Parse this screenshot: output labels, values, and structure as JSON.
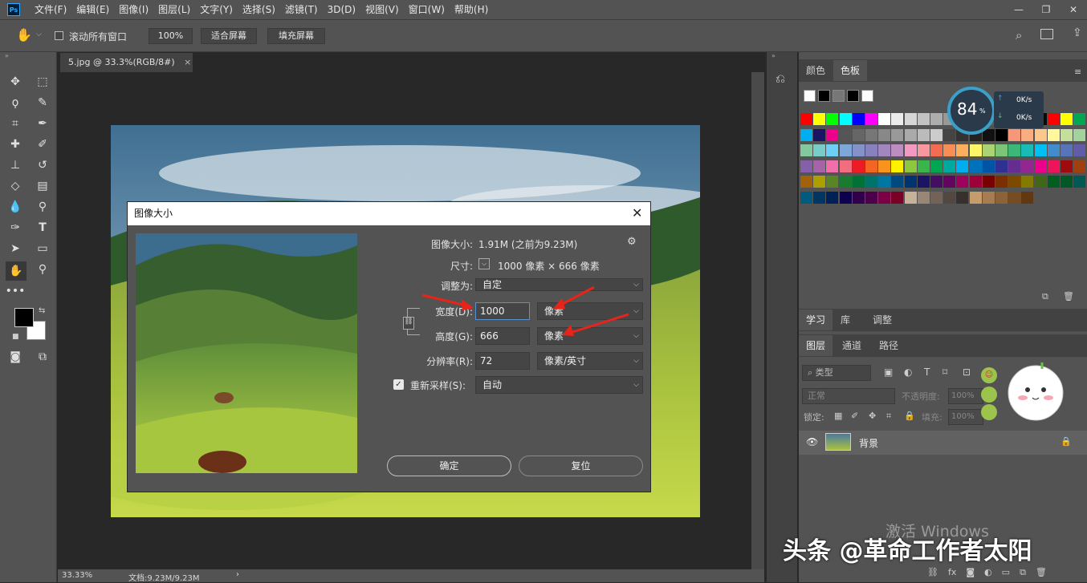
{
  "menubar": {
    "items": [
      "文件(F)",
      "编辑(E)",
      "图像(I)",
      "图层(L)",
      "文字(Y)",
      "选择(S)",
      "滤镜(T)",
      "3D(D)",
      "视图(V)",
      "窗口(W)",
      "帮助(H)"
    ],
    "logo": "Ps"
  },
  "options": {
    "scroll_all_label": "滚动所有窗口",
    "zoom_value": "100%",
    "fit_screen_label": "适合屏幕",
    "fill_screen_label": "填充屏幕"
  },
  "document": {
    "tab_title": "5.jpg @ 33.3%(RGB/8#)",
    "close_glyph": "×"
  },
  "statusbar": {
    "zoom": "33.33%",
    "doc_info": "文档:9.23M/9.23M",
    "arrow": "›"
  },
  "panels": {
    "color_tab": "颜色",
    "swatches_tab": "色板",
    "learn_tab": "学习",
    "library_tab": "库",
    "adjust_tab": "调整",
    "layers_tab": "图层",
    "channels_tab": "通道",
    "paths_tab": "路径",
    "filter_kind": "类型",
    "blend_mode": "正常",
    "opacity_label": "不透明度:",
    "opacity_value": "100%",
    "lock_label": "锁定:",
    "fill_label": "填充:",
    "fill_value": "100%",
    "layer_name": "背景"
  },
  "speed_widget": {
    "percent": "84",
    "percent_sign": "%",
    "up_speed": "0K/s",
    "down_speed": "0K/s"
  },
  "dialog": {
    "title": "图像大小",
    "image_size_label": "图像大小:",
    "image_size_value": "1.91M (之前为9.23M)",
    "dimension_label": "尺寸:",
    "dimension_value": "1000 像素 × 666 像素",
    "fit_to_label": "调整为:",
    "fit_to_value": "自定",
    "width_label": "宽度(D):",
    "width_value": "1000",
    "width_unit": "像素",
    "height_label": "高度(G):",
    "height_value": "666",
    "height_unit": "像素",
    "resolution_label": "分辨率(R):",
    "resolution_value": "72",
    "resolution_unit": "像素/英寸",
    "resample_label": "重新采样(S):",
    "resample_value": "自动",
    "resample_checked": true,
    "ok_label": "确定",
    "reset_label": "复位"
  },
  "overlay": {
    "watermark": "头条 @革命工作者太阳",
    "windows_activation": "激活 Windows"
  },
  "colors": {
    "accent": "#31a8ff",
    "arrow": "#e8241a",
    "panel_bg": "#535353",
    "canvas_bg": "#282828"
  },
  "swatch_rows": [
    [
      "#ffffff",
      "#000000",
      "#777777",
      "#000000",
      "#ffffff"
    ],
    [
      "#ff0000",
      "#ffff00",
      "#00ff00",
      "#00ffff",
      "#0000ff",
      "#ff00ff",
      "#ffffff",
      "#ebebeb",
      "#d6d6d6",
      "#c2c2c2",
      "#adadad",
      "#999999",
      "#858585",
      "#707070",
      "#5c5c5c",
      "#474747",
      "#333333",
      "#1f1f1f",
      "#0a0a0a",
      "#ff0000",
      "#ffff00",
      "#00a651"
    ],
    [
      "#00aeef",
      "#1b1464",
      "#ec008c",
      "#555555",
      "#666666",
      "#777777",
      "#888888",
      "#999999",
      "#aaaaaa",
      "#bbbbbb",
      "#cccccc",
      "#444444",
      "#333333",
      "#222222",
      "#111111",
      "#000000",
      "#f7977a",
      "#f9ad81",
      "#fdc68a",
      "#fff79a",
      "#c4df9b",
      "#a3d39c"
    ],
    [
      "#82ca9d",
      "#7accc8",
      "#6dcff6",
      "#7da7d9",
      "#8393ca",
      "#8781bd",
      "#a187be",
      "#bc8dbf",
      "#f49ac2",
      "#f6989d",
      "#f26c4f",
      "#f68e56",
      "#fbaf5d",
      "#fff568",
      "#acd373",
      "#7cc576",
      "#3bb878",
      "#1abbb4",
      "#00bff3",
      "#438ccb",
      "#5674b9",
      "#605ca8"
    ],
    [
      "#855fa8",
      "#a763a8",
      "#f06ea9",
      "#f26d7d",
      "#ed1c24",
      "#f26522",
      "#f7941d",
      "#fff200",
      "#8dc63f",
      "#39b54a",
      "#00a651",
      "#00a99d",
      "#00aeef",
      "#0072bc",
      "#0054a6",
      "#2e3192",
      "#662d91",
      "#92278f",
      "#ec008c",
      "#ed145b",
      "#9e0b0f",
      "#a0410d"
    ],
    [
      "#a3620a",
      "#aba000",
      "#598527",
      "#197b30",
      "#007236",
      "#00746b",
      "#0076a3",
      "#004a80",
      "#003471",
      "#1b1464",
      "#440e62",
      "#630460",
      "#9e005d",
      "#9e0039",
      "#790000",
      "#7b2e00",
      "#7d4900",
      "#827b00",
      "#406618",
      "#005e20",
      "#005826",
      "#005952"
    ],
    [
      "#005b7f",
      "#003663",
      "#002157",
      "#0d004c",
      "#32004b",
      "#4b0049",
      "#7b0046",
      "#7a0026",
      "#c7b299",
      "#998675",
      "#736357",
      "#534741",
      "#37302d",
      "#c69c6d",
      "#a67c52",
      "#8c6239",
      "#754c24",
      "#603913"
    ]
  ]
}
